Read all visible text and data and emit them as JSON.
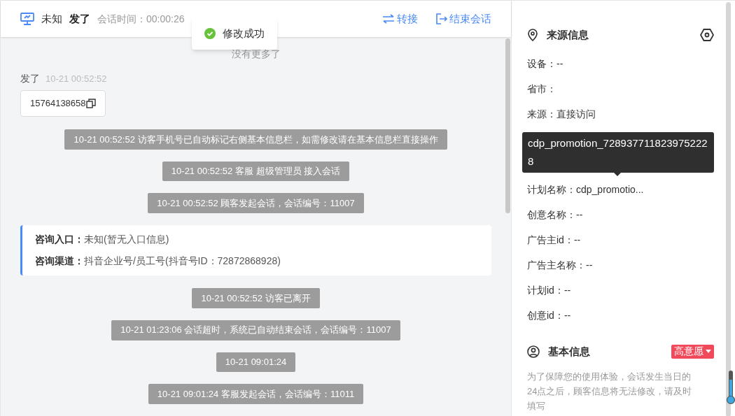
{
  "header": {
    "visitor_name": "未知",
    "customer_name": "发了",
    "session_time_label": "会话时间：",
    "session_time": "00:00:26",
    "actions": [
      {
        "kind": "transfer",
        "label": "转接"
      },
      {
        "kind": "end",
        "label": "结束会话"
      }
    ]
  },
  "toast": {
    "kind": "success",
    "text": "修改成功"
  },
  "chat": {
    "no_more": "没有更多了",
    "messages": [
      {
        "kind": "visitor",
        "sender": "发了",
        "time": "10-21 00:52:52",
        "text": "15764138658"
      },
      {
        "kind": "system",
        "text": "10-21 00:52:52 访客手机号已自动标记右侧基本信息栏，如需修改请在基本信息栏直接操作"
      },
      {
        "kind": "system",
        "text": "10-21 00:52:52 客服 超级管理员 接入会话"
      },
      {
        "kind": "system",
        "text": "10-21 00:52:52 顾客发起会话，会话编号：11007"
      },
      {
        "kind": "info",
        "lines": [
          {
            "label": "咨询入口：",
            "value": "未知(暂无入口信息)"
          },
          {
            "label": "咨询渠道：",
            "value": "抖音企业号/员工号(抖音号ID：72872868928)"
          }
        ]
      },
      {
        "kind": "system",
        "text": "10-21 00:52:52 访客已离开"
      },
      {
        "kind": "system",
        "text": "10-21 01:23:06 会话超时，系统已自动结束会话，会话编号：11007"
      },
      {
        "kind": "system",
        "text": "10-21 09:01:24"
      },
      {
        "kind": "system",
        "text": "10-21 09:01:24 客服发起会话，会话编号：11011"
      }
    ]
  },
  "source_info": {
    "title": "来源信息",
    "fields": [
      {
        "text": "设备：--"
      },
      {
        "text": "省市："
      },
      {
        "text": "来源：直接访问"
      },
      {
        "text": "计划名称：cdp_promotio..."
      },
      {
        "text": "创意名称：--"
      },
      {
        "text": "广告主id：--"
      },
      {
        "text": "广告主名称：--"
      },
      {
        "text": "计划id：--"
      },
      {
        "text": "创意id：--"
      }
    ],
    "tooltip": {
      "text": "cdp_promotion_7289377118239752228"
    }
  },
  "basic_info": {
    "title": "基本信息",
    "intent_tag": "高意愿",
    "notice": "为了保障您的使用体验，会话发生当日的24点之后，顾客信息将无法修改，请及时填写"
  }
}
